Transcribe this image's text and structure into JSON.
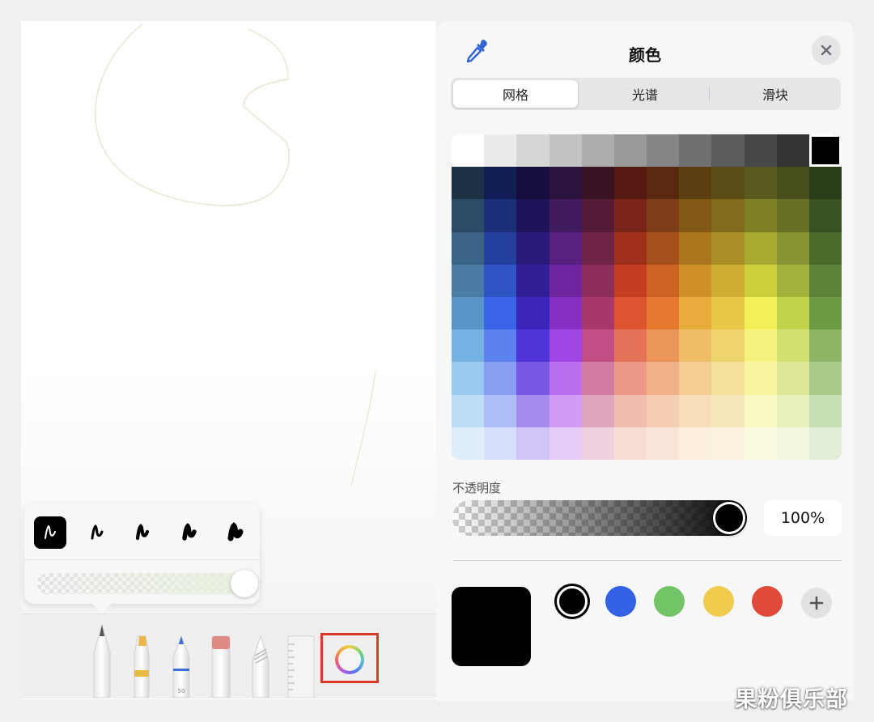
{
  "panel": {
    "title": "颜色",
    "tabs": [
      {
        "label": "网格",
        "active": true
      },
      {
        "label": "光谱",
        "active": false
      },
      {
        "label": "滑块",
        "active": false
      }
    ],
    "opacity_label": "不透明度",
    "opacity_value": "100%",
    "opacity_level": 1.0,
    "current_color": "#000000",
    "swatches": [
      "#000000",
      "#3461e8",
      "#72c466",
      "#f0cb4e",
      "#df4a3b"
    ],
    "icons": {
      "eyedropper": "eyedropper-icon",
      "close": "close-icon",
      "add": "plus-icon"
    }
  },
  "grid_colors": [
    [
      "#ffffff",
      "#ebebeb",
      "#d6d6d6",
      "#c2c2c2",
      "#adadad",
      "#999999",
      "#858585",
      "#707070",
      "#5c5c5c",
      "#474747",
      "#333333",
      "#000000"
    ],
    [
      "#1e3245",
      "#111d55",
      "#180e3d",
      "#2b1440",
      "#3a1225",
      "#561912",
      "#5a2a10",
      "#5c3e11",
      "#5b4c16",
      "#595a1d",
      "#484f1a",
      "#2a3d18"
    ],
    [
      "#2a4a66",
      "#1b2e7a",
      "#1f145a",
      "#3f1a5e",
      "#541b36",
      "#7a2318",
      "#803c17",
      "#825816",
      "#816c1d",
      "#7f8126",
      "#677025",
      "#3a5222"
    ],
    [
      "#3a6387",
      "#24409f",
      "#29197a",
      "#571f80",
      "#702448",
      "#a0301c",
      "#a7501d",
      "#aa751d",
      "#a98e25",
      "#a7a931",
      "#879230",
      "#4a6a2c"
    ],
    [
      "#4b7ca6",
      "#2f54c4",
      "#311f98",
      "#6e26a0",
      "#8c2d5a",
      "#c63e22",
      "#cc6223",
      "#cf9127",
      "#cfad30",
      "#cdcf3c",
      "#a4b23b",
      "#5b8336"
    ],
    [
      "#5b95c8",
      "#3a64e8",
      "#3b25b8",
      "#8530c2",
      "#a6386c",
      "#de5330",
      "#e6792f",
      "#e9aa3c",
      "#e8c646",
      "#f2ef58",
      "#c0d24a",
      "#6d9a42"
    ],
    [
      "#77b2e4",
      "#5c82ef",
      "#5235d8",
      "#a046e6",
      "#c14e84",
      "#e4735a",
      "#eb955a",
      "#efbd67",
      "#efd46e",
      "#f6f27d",
      "#d1e070",
      "#8cb565"
    ],
    [
      "#9bcaef",
      "#869ff2",
      "#7a58e6",
      "#bb6ef0",
      "#d27aa0",
      "#eb9887",
      "#f0b187",
      "#f3cd92",
      "#f3df98",
      "#f8f5a0",
      "#dfe898",
      "#abcb8c"
    ],
    [
      "#bedcf4",
      "#adbff6",
      "#a38cee",
      "#d29bf4",
      "#e1a4bf",
      "#f1bbae",
      "#f5cdb0",
      "#f7ddb8",
      "#f7e8bc",
      "#faf8c2",
      "#e9f0bb",
      "#c8deb3"
    ],
    [
      "#dfedf9",
      "#d6dff9",
      "#d0c5f6",
      "#e8cdf9",
      "#efd1df",
      "#f7ddd6",
      "#f9e6d8",
      "#fbeedc",
      "#fbf3de",
      "#fcfbe1",
      "#f4f7dd",
      "#e3eed9"
    ]
  ]
}
